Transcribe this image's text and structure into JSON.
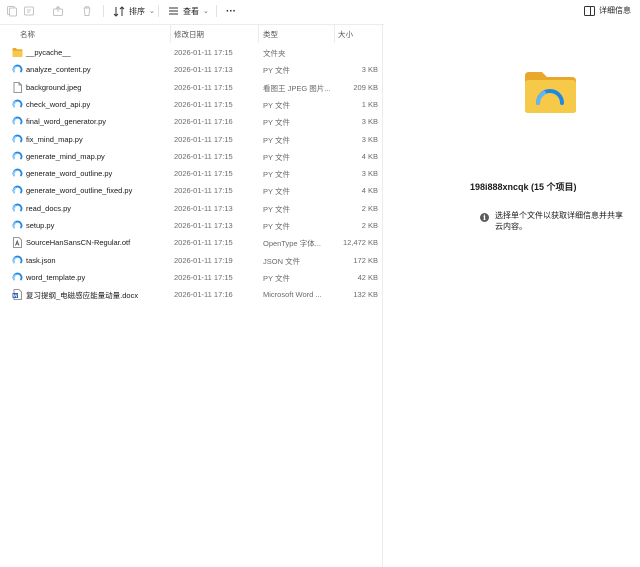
{
  "toolbar": {
    "sort_label": "排序",
    "view_label": "查看",
    "more_label": "···",
    "details_label": "详细信息"
  },
  "columns": {
    "name": "名称",
    "modified": "修改日期",
    "type": "类型",
    "size": "大小"
  },
  "files": [
    {
      "name": "__pycache__",
      "date": "2026-01-11 17:15",
      "type": "文件夹",
      "size": "",
      "icon": "folder-icon"
    },
    {
      "name": "analyze_content.py",
      "date": "2026-01-11 17:13",
      "type": "PY 文件",
      "size": "3 KB",
      "icon": "python-file-icon"
    },
    {
      "name": "background.jpeg",
      "date": "2026-01-11 17:15",
      "type": "看图王 JPEG 图片...",
      "size": "209 KB",
      "icon": "image-file-icon"
    },
    {
      "name": "check_word_api.py",
      "date": "2026-01-11 17:15",
      "type": "PY 文件",
      "size": "1 KB",
      "icon": "python-file-icon"
    },
    {
      "name": "final_word_generator.py",
      "date": "2026-01-11 17:16",
      "type": "PY 文件",
      "size": "3 KB",
      "icon": "python-file-icon"
    },
    {
      "name": "fix_mind_map.py",
      "date": "2026-01-11 17:15",
      "type": "PY 文件",
      "size": "3 KB",
      "icon": "python-file-icon"
    },
    {
      "name": "generate_mind_map.py",
      "date": "2026-01-11 17:15",
      "type": "PY 文件",
      "size": "4 KB",
      "icon": "python-file-icon"
    },
    {
      "name": "generate_word_outline.py",
      "date": "2026-01-11 17:15",
      "type": "PY 文件",
      "size": "3 KB",
      "icon": "python-file-icon"
    },
    {
      "name": "generate_word_outline_fixed.py",
      "date": "2026-01-11 17:15",
      "type": "PY 文件",
      "size": "4 KB",
      "icon": "python-file-icon"
    },
    {
      "name": "read_docs.py",
      "date": "2026-01-11 17:13",
      "type": "PY 文件",
      "size": "2 KB",
      "icon": "python-file-icon"
    },
    {
      "name": "setup.py",
      "date": "2026-01-11 17:13",
      "type": "PY 文件",
      "size": "2 KB",
      "icon": "python-file-icon"
    },
    {
      "name": "SourceHanSansCN-Regular.otf",
      "date": "2026-01-11 17:15",
      "type": "OpenType 字体...",
      "size": "12,472 KB",
      "icon": "font-file-icon"
    },
    {
      "name": "task.json",
      "date": "2026-01-11 17:19",
      "type": "JSON 文件",
      "size": "172 KB",
      "icon": "json-file-icon"
    },
    {
      "name": "word_template.py",
      "date": "2026-01-11 17:15",
      "type": "PY 文件",
      "size": "42 KB",
      "icon": "python-file-icon"
    },
    {
      "name": "复习提纲_电磁感应能量动量.docx",
      "date": "2026-01-11 17:16",
      "type": "Microsoft Word ...",
      "size": "132 KB",
      "icon": "word-file-icon"
    }
  ],
  "details": {
    "folder_name": "198i888xncqk (15 个项目)",
    "hint": "选择单个文件以获取详细信息并共享云内容。"
  },
  "colors": {
    "python_blue": "#1e88e5",
    "folder_yellow": "#f5c242",
    "word_blue": "#2b5fb4"
  }
}
